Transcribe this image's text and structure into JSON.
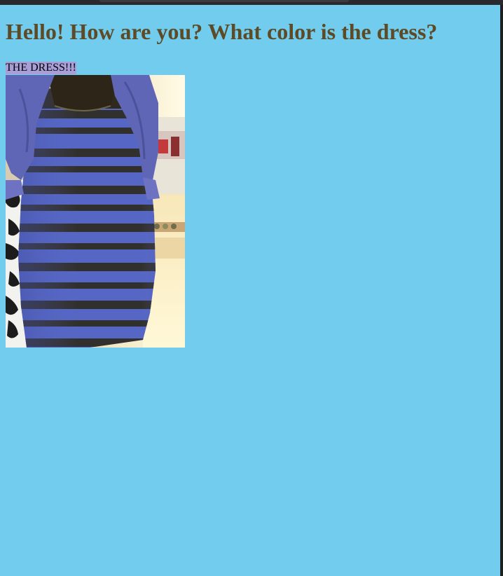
{
  "page": {
    "heading": "Hello! How are you? What color is the dress?",
    "caption": "THE DRESS!!!",
    "background_color": "#71cced",
    "heading_color": "#5d4b28",
    "caption_highlight_color": "#a89ed8"
  },
  "photo": {
    "subject": "dress-photo",
    "colors": {
      "dress_blue": "#5566c4",
      "lace_black": "#2f2a1c",
      "shoulder_wrap": "#5f66b6",
      "background_light": "#fff6d8"
    }
  }
}
